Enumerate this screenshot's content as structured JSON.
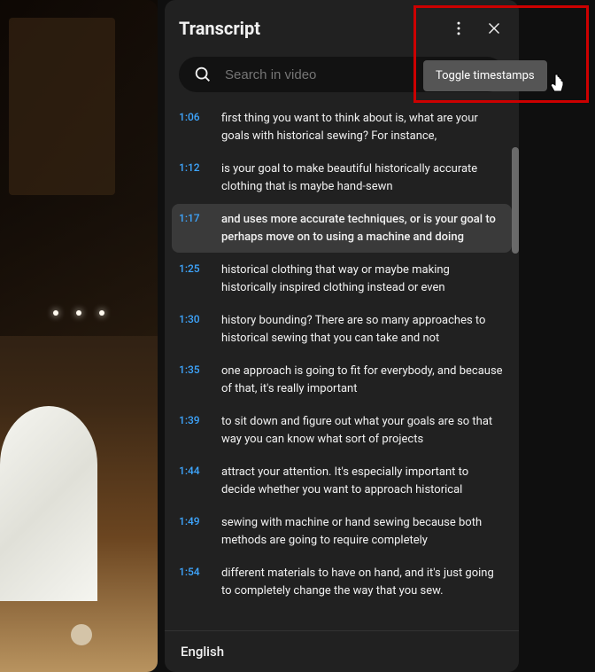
{
  "panel": {
    "title": "Transcript",
    "search_placeholder": "Search in video",
    "language": "English"
  },
  "tooltip": {
    "text": "Toggle timestamps"
  },
  "transcript": [
    {
      "time": "1:06",
      "text": "first thing you want to think about is, what are  your goals with historical sewing? For instance,",
      "active": false
    },
    {
      "time": "1:12",
      "text": "is your goal to make beautiful historically  accurate clothing that is maybe hand-sewn",
      "active": false
    },
    {
      "time": "1:17",
      "text": "and uses more accurate techniques, or is your goal  to perhaps move on to using a machine and doing",
      "active": true
    },
    {
      "time": "1:25",
      "text": "historical clothing that way or maybe making  historically inspired clothing instead or even",
      "active": false
    },
    {
      "time": "1:30",
      "text": "history bounding? There are so many approaches  to historical sewing that you can take and not",
      "active": false
    },
    {
      "time": "1:35",
      "text": "one approach is going to fit for everybody,  and because of that, it's really important",
      "active": false
    },
    {
      "time": "1:39",
      "text": "to sit down and figure out what your goals are  so that way you can know what sort of projects",
      "active": false
    },
    {
      "time": "1:44",
      "text": "attract your attention. It's especially important  to decide whether you want to approach historical",
      "active": false
    },
    {
      "time": "1:49",
      "text": "sewing with machine or hand sewing because  both methods are going to require completely",
      "active": false
    },
    {
      "time": "1:54",
      "text": "different materials to have on hand, and it's just  going to completely change the way that you sew.",
      "active": false
    }
  ]
}
